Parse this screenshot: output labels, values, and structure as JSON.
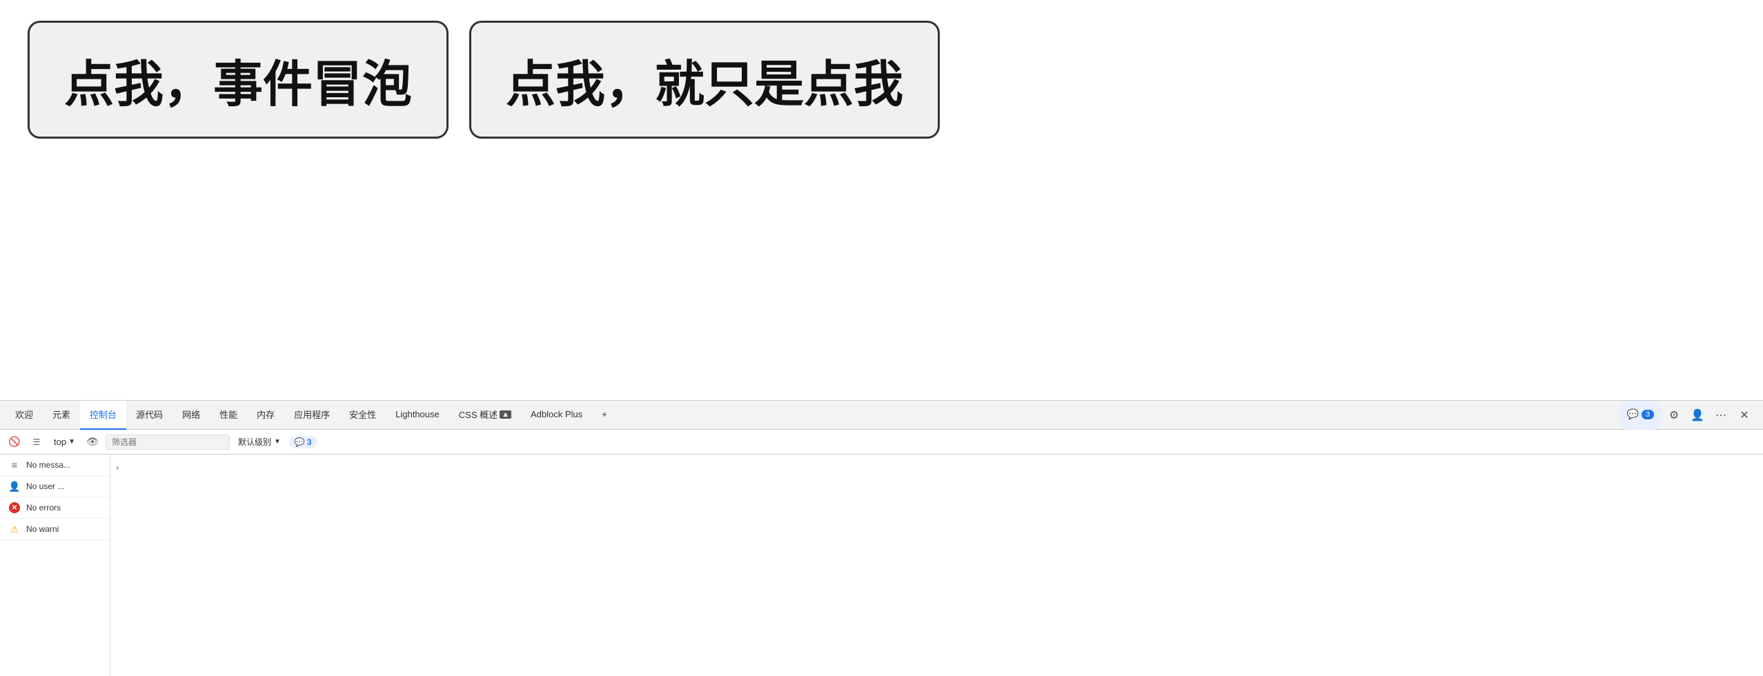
{
  "page": {
    "bg": "#ffffff"
  },
  "buttons": {
    "bubble_label": "点我，事件冒泡",
    "click_label": "点我，就只是点我"
  },
  "devtools": {
    "tabs": [
      {
        "id": "welcome",
        "label": "欢迎",
        "active": false
      },
      {
        "id": "elements",
        "label": "元素",
        "active": false
      },
      {
        "id": "console",
        "label": "控制台",
        "active": true
      },
      {
        "id": "sources",
        "label": "源代码",
        "active": false
      },
      {
        "id": "network",
        "label": "网络",
        "active": false
      },
      {
        "id": "performance",
        "label": "性能",
        "active": false
      },
      {
        "id": "memory",
        "label": "内存",
        "active": false
      },
      {
        "id": "application",
        "label": "应用程序",
        "active": false
      },
      {
        "id": "security",
        "label": "安全性",
        "active": false
      },
      {
        "id": "lighthouse",
        "label": "Lighthouse",
        "active": false
      },
      {
        "id": "css-overview",
        "label": "CSS 概述",
        "active": false
      },
      {
        "id": "adblock",
        "label": "Adblock Plus",
        "active": false
      }
    ],
    "tab_badge_count": "3",
    "toolbar": {
      "context_label": "top",
      "filter_placeholder": "筛选器",
      "level_label": "默认级别",
      "message_count": "3"
    },
    "sidebar": {
      "items": [
        {
          "id": "all-messages",
          "label": "No messa...",
          "icon": "list"
        },
        {
          "id": "user-messages",
          "label": "No user ...",
          "icon": "user"
        },
        {
          "id": "errors",
          "label": "No errors",
          "icon": "error"
        },
        {
          "id": "warnings",
          "label": "No warni",
          "icon": "warning"
        }
      ]
    },
    "settings_gear": "⚙",
    "profile_icon": "👤",
    "more_icon": "⋯",
    "close_icon": "✕",
    "add_tab_icon": "+",
    "badge_blue_bg": "#1a73e8"
  }
}
